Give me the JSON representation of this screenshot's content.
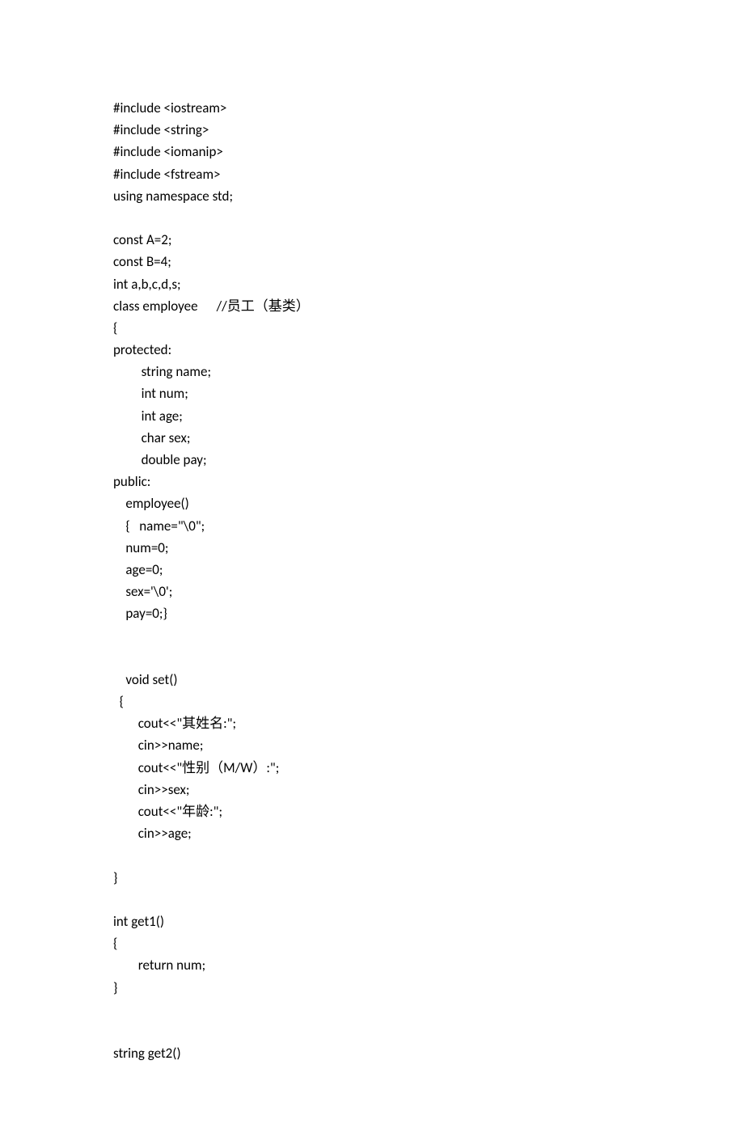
{
  "lines": [
    "#include <iostream>",
    "#include <string>",
    "#include <iomanip>",
    "#include <fstream>",
    "using namespace std;",
    "",
    "const A=2;",
    "const B=4;",
    "int a,b,c,d,s;",
    "class employee      //员工（基类）",
    "{",
    "protected:",
    "         string name;",
    "         int num;",
    "         int age;",
    "         char sex;",
    "         double pay;",
    "public:",
    "    employee()",
    "    {   name=\"\\0\";",
    "    num=0;",
    "    age=0;",
    "    sex='\\0';",
    "    pay=0;}",
    "",
    "",
    "    void set()",
    "  {",
    "        cout<<\"其姓名:\";",
    "        cin>>name;",
    "        cout<<\"性别（M/W）:\";",
    "        cin>>sex;",
    "        cout<<\"年龄:\";",
    "        cin>>age;",
    "",
    "}",
    "",
    "int get1()",
    "{",
    "        return num;",
    "}",
    "",
    "",
    "string get2()"
  ]
}
